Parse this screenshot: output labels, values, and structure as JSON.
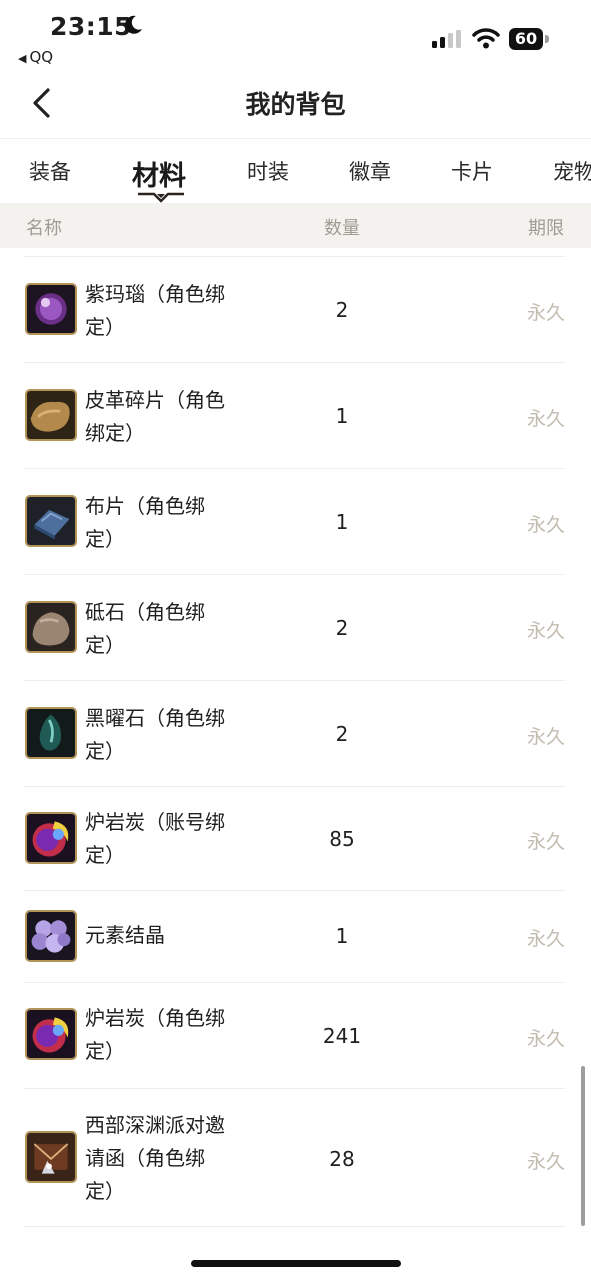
{
  "status_bar": {
    "time": "23:15",
    "back_app": "QQ",
    "battery": "60"
  },
  "navbar": {
    "title": "我的背包"
  },
  "tabs": [
    {
      "label": "装备",
      "active": false
    },
    {
      "label": "材料",
      "active": true
    },
    {
      "label": "时装",
      "active": false
    },
    {
      "label": "徽章",
      "active": false
    },
    {
      "label": "卡片",
      "active": false
    },
    {
      "label": "宠物",
      "active": false
    }
  ],
  "table_header": {
    "name": "名称",
    "quantity": "数量",
    "expiry": "期限"
  },
  "items": [
    {
      "name": "紫玛瑙（角色绑定）",
      "quantity": "2",
      "expiry": "永久",
      "icon": "purple-agate-icon"
    },
    {
      "name": "皮革碎片（角色绑定）",
      "quantity": "1",
      "expiry": "永久",
      "icon": "leather-scrap-icon"
    },
    {
      "name": "布片（角色绑定）",
      "quantity": "1",
      "expiry": "永久",
      "icon": "cloth-piece-icon"
    },
    {
      "name": "砥石（角色绑定）",
      "quantity": "2",
      "expiry": "永久",
      "icon": "whetstone-icon"
    },
    {
      "name": "黑曜石（角色绑定）",
      "quantity": "2",
      "expiry": "永久",
      "icon": "obsidian-icon"
    },
    {
      "name": "炉岩炭（账号绑定）",
      "quantity": "85",
      "expiry": "永久",
      "icon": "furnace-coal-icon"
    },
    {
      "name": "元素结晶",
      "quantity": "1",
      "expiry": "永久",
      "icon": "element-crystal-icon"
    },
    {
      "name": "炉岩炭（角色绑定）",
      "quantity": "241",
      "expiry": "永久",
      "icon": "furnace-coal-icon"
    },
    {
      "name": "西部深渊派对邀请函（角色绑定）",
      "quantity": "28",
      "expiry": "永久",
      "icon": "invitation-icon"
    }
  ]
}
